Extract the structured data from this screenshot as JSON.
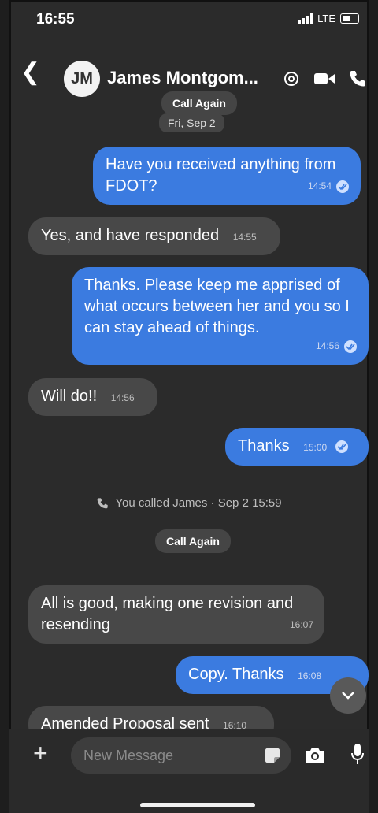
{
  "status_bar": {
    "time": "16:55",
    "network": "LTE"
  },
  "header": {
    "avatar_initials": "JM",
    "contact_name": "James Montgom..."
  },
  "top_call_again": "Call Again",
  "date_separator": "Fri, Sep 2",
  "messages": [
    {
      "dir": "out",
      "text": "Have you received anything from FDOT?",
      "time": "14:54"
    },
    {
      "dir": "in",
      "text": "Yes, and have responded",
      "time": "14:55"
    },
    {
      "dir": "out",
      "text": "Thanks. Please keep me apprised of what occurs between her and you so I can stay ahead of things.",
      "time": "14:56"
    },
    {
      "dir": "in",
      "text": "Will do!!",
      "time": "14:56"
    },
    {
      "dir": "out",
      "text": "Thanks",
      "time": "15:00"
    },
    {
      "dir": "in",
      "text": "All is good, making one revision and resending",
      "time": "16:07"
    },
    {
      "dir": "out",
      "text": "Copy. Thanks",
      "time": "16:08"
    },
    {
      "dir": "in",
      "text": "Amended Proposal sent",
      "time": "16:10"
    }
  ],
  "call_log": "You called James · Sep 2 15:59",
  "call_again": "Call Again",
  "input": {
    "placeholder": "New Message"
  }
}
